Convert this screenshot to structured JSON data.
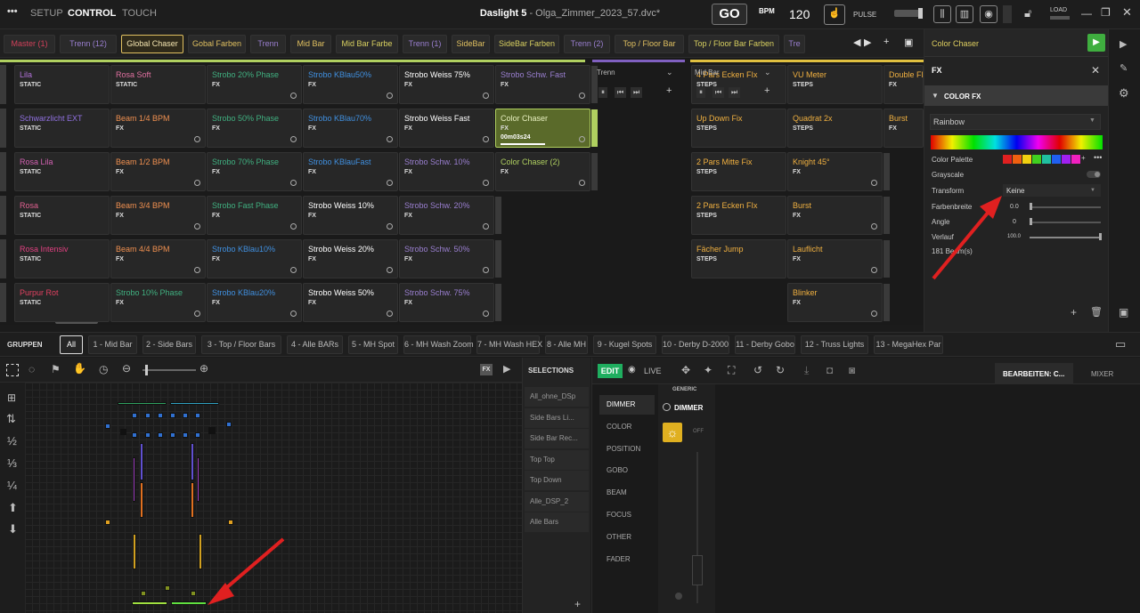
{
  "topbar": {
    "menu_icon": "dots-icon",
    "tabs": [
      "SETUP",
      "CONTROL",
      "TOUCH"
    ],
    "app": "Daslight 5",
    "file": " - Olga_Zimmer_2023_57.dvc*",
    "go": "GO",
    "bpm_label": "BPM",
    "bpm_value": "120",
    "pulse": "PULSE",
    "load": "LOAD"
  },
  "pages": [
    {
      "label": "Master (1)",
      "color": "#d0405a"
    },
    {
      "label": "Trenn (12)",
      "color": "#9a7fd0"
    },
    {
      "label": "Global Chaser",
      "color": "#f5e6b0"
    },
    {
      "label": "Gobal Farben",
      "color": "#e0c060"
    },
    {
      "label": "Trenn",
      "color": "#9a7fd0"
    },
    {
      "label": "Mid Bar",
      "color": "#e0c060"
    },
    {
      "label": "Mid Bar Farbe",
      "color": "#d8d060"
    },
    {
      "label": "Trenn (1)",
      "color": "#9a7fd0"
    },
    {
      "label": "SideBar",
      "color": "#e0c060"
    },
    {
      "label": "SideBar Farben",
      "color": "#d8d060"
    },
    {
      "label": "Trenn (2)",
      "color": "#9a7fd0"
    },
    {
      "label": "Top / Floor Bar",
      "color": "#e0c060"
    },
    {
      "label": "Top / Floor Bar Farben",
      "color": "#d8d060"
    },
    {
      "label": "Tre",
      "color": "#9a7fd0"
    }
  ],
  "scenes": {
    "col1": [
      {
        "name": "Lila",
        "type": "STATIC",
        "color": "#b070d8"
      },
      {
        "name": "Schwarzlicht EXT",
        "type": "STATIC",
        "color": "#9070e0"
      },
      {
        "name": "Rosa Lila",
        "type": "STATIC",
        "color": "#d060b0"
      },
      {
        "name": "Rosa",
        "type": "STATIC",
        "color": "#e06090"
      },
      {
        "name": "Rosa Intensiv",
        "type": "STATIC",
        "color": "#e04080"
      },
      {
        "name": "Purpur Rot",
        "type": "STATIC",
        "color": "#e04060"
      }
    ],
    "col2": [
      {
        "name": "Rosa Soft",
        "type": "STATIC",
        "color": "#e070a0"
      },
      {
        "name": "Beam 1/4 BPM",
        "type": "FX",
        "color": "#f09050"
      },
      {
        "name": "Beam 1/2 BPM",
        "type": "FX",
        "color": "#f09050"
      },
      {
        "name": "Beam 3/4 BPM",
        "type": "FX",
        "color": "#f09050"
      },
      {
        "name": "Beam 4/4 BPM",
        "type": "FX",
        "color": "#f09050"
      },
      {
        "name": "Strobo 10% Phase",
        "type": "FX",
        "color": "#40b080"
      }
    ],
    "col3": [
      {
        "name": "Strobo 20% Phase",
        "type": "FX",
        "color": "#40b080"
      },
      {
        "name": "Strobo 50% Phase",
        "type": "FX",
        "color": "#40b080"
      },
      {
        "name": "Strobo 70% Phase",
        "type": "FX",
        "color": "#40b080"
      },
      {
        "name": "Strobo Fast Phase",
        "type": "FX",
        "color": "#40b080"
      },
      {
        "name": "Strobo KBlau10%",
        "type": "FX",
        "color": "#4090e0"
      },
      {
        "name": "Strobo KBlau20%",
        "type": "FX",
        "color": "#4090e0"
      }
    ],
    "col4": [
      {
        "name": "Strobo KBlau50%",
        "type": "FX",
        "color": "#4090e0"
      },
      {
        "name": "Strobo KBlau70%",
        "type": "FX",
        "color": "#4090e0"
      },
      {
        "name": "Strobo KBlauFast",
        "type": "FX",
        "color": "#4090e0"
      },
      {
        "name": "Strobo Weiss 10%",
        "type": "FX",
        "color": "#ffffff"
      },
      {
        "name": "Strobo Weiss 20%",
        "type": "FX",
        "color": "#ffffff"
      },
      {
        "name": "Strobo Weiss 50%",
        "type": "FX",
        "color": "#ffffff"
      }
    ],
    "col5": [
      {
        "name": "Strobo Weiss 75%",
        "type": "FX",
        "color": "#ffffff"
      },
      {
        "name": "Strobo Weiss Fast",
        "type": "FX",
        "color": "#ffffff"
      },
      {
        "name": "Strobo Schw. 10%",
        "type": "FX",
        "color": "#9a7fd0"
      },
      {
        "name": "Strobo Schw. 20%",
        "type": "FX",
        "color": "#9a7fd0"
      },
      {
        "name": "Strobo Schw. 50%",
        "type": "FX",
        "color": "#9a7fd0"
      },
      {
        "name": "Strobo Schw. 75%",
        "type": "FX",
        "color": "#9a7fd0"
      }
    ],
    "col6": [
      {
        "name": "Strobo Schw. Fast",
        "type": "FX",
        "color": "#9a7fd0"
      },
      {
        "name": "Color Chaser",
        "type": "FX",
        "color": "#e8f0c0",
        "time": "00m03s24",
        "active": true
      },
      {
        "name": "Color Chaser (2)",
        "type": "FX",
        "color": "#b0d060"
      }
    ],
    "col8": [
      {
        "name": "4 Pars Ecken FIx",
        "type": "STEPS",
        "color": "#f0b040"
      },
      {
        "name": "Up Down Fix",
        "type": "STEPS",
        "color": "#f0b040"
      },
      {
        "name": "2 Pars Mitte Fix",
        "type": "STEPS",
        "color": "#f0b040"
      },
      {
        "name": "2 Pars Ecken FIx",
        "type": "STEPS",
        "color": "#f0b040"
      },
      {
        "name": "Fächer Jump",
        "type": "STEPS",
        "color": "#f0b040"
      }
    ],
    "col9": [
      {
        "name": "VU Meter",
        "type": "STEPS",
        "color": "#f0b040"
      },
      {
        "name": "Quadrat 2x",
        "type": "STEPS",
        "color": "#f0b040"
      },
      {
        "name": "Knight 45°",
        "type": "FX",
        "color": "#f0b040"
      },
      {
        "name": "Burst",
        "type": "FX",
        "color": "#f0b040"
      },
      {
        "name": "Lauflicht",
        "type": "FX",
        "color": "#f0b040"
      },
      {
        "name": "Blinker",
        "type": "FX",
        "color": "#f0b040"
      }
    ],
    "col10": [
      {
        "name": "Double Fla",
        "type": "FX",
        "color": "#f0b040"
      },
      {
        "name": "Burst",
        "type": "FX",
        "color": "#f0b040"
      }
    ],
    "trenn_header": "Trenn",
    "midbar_header": "Mid Bar"
  },
  "right_panel": {
    "scene_name": "Color Chaser",
    "fx_label": "FX",
    "section": "COLOR FX",
    "preset": "Rainbow",
    "color_palette": "Color Palette",
    "grayscale": "Grayscale",
    "transform": "Transform",
    "transform_value": "Keine",
    "farbenbreite": "Farbenbreite",
    "farbenbreite_value": "0.0",
    "angle": "Angle",
    "angle_value": "0",
    "verlauf": "Verlauf",
    "verlauf_value": "100.0",
    "beams": "181 Beam(s)",
    "palette_colors": [
      "#e02020",
      "#f06010",
      "#f0d010",
      "#40d020",
      "#20c0a0",
      "#2060f0",
      "#a020f0",
      "#f020c0"
    ]
  },
  "groups": {
    "label": "GRUPPEN",
    "tabs": [
      "All",
      "1 - Mid Bar",
      "2 - Side Bars",
      "3 - Top / Floor Bars",
      "4 - Alle BARs",
      "5 - MH Spot",
      "6 - MH Wash Zoom",
      "7 - MH Wash HEX",
      "8 - Alle MH",
      "9 - Kugel Spots",
      "10 - Derby D-2000",
      "11 - Derby Gobo",
      "12 - Truss Lights",
      "13 - MegaHex Par"
    ]
  },
  "selections": {
    "title": "SELECTIONS",
    "items": [
      "All_ohne_DSp",
      "Side Bars Li...",
      "Side Bar Rec...",
      "Top Top",
      "Top Down",
      "Alle_DSP_2",
      "Alle Bars"
    ]
  },
  "editor": {
    "edit": "EDIT",
    "live": "LIVE",
    "bearbeiten": "BEARBEITEN: C...",
    "mixer": "MIXER",
    "attributes": [
      "DIMMER",
      "COLOR",
      "POSITION",
      "GOBO",
      "BEAM",
      "FOCUS",
      "OTHER",
      "FADER"
    ],
    "generic": "GENERIC",
    "dimmer": "DIMMER",
    "off": "OFF"
  },
  "fractions": [
    "½",
    "⅓",
    "¼"
  ]
}
